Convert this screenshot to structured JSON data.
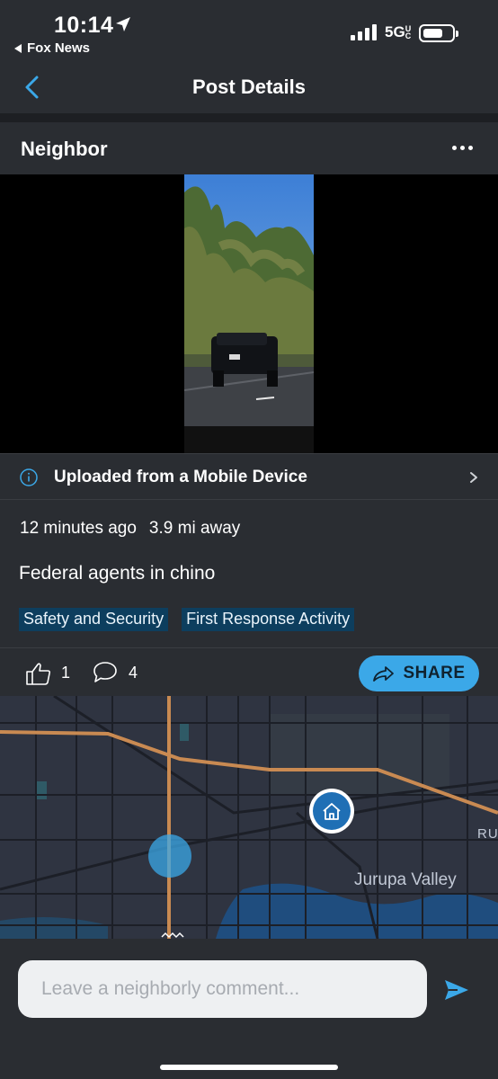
{
  "status_bar": {
    "time": "10:14",
    "back_app": "Fox News",
    "network": "5G",
    "network_suffix": "UC"
  },
  "nav": {
    "title": "Post Details"
  },
  "post": {
    "author": "Neighbor",
    "upload_source": "Uploaded from a Mobile Device",
    "time_ago": "12 minutes ago",
    "distance": "3.9 mi away",
    "text": "Federal agents in chino",
    "tags": [
      "Safety and Security",
      "First Response Activity"
    ],
    "likes": "1",
    "comments": "4",
    "share_label": "SHARE"
  },
  "map": {
    "place_label": "Jurupa Valley",
    "edge_label": "RU"
  },
  "comment_box": {
    "placeholder": "Leave a neighborly comment..."
  },
  "colors": {
    "accent": "#3ba8e8",
    "background": "#2a2d32",
    "tag_bg": "#0d3e5e",
    "road_highway": "#c98a52"
  }
}
